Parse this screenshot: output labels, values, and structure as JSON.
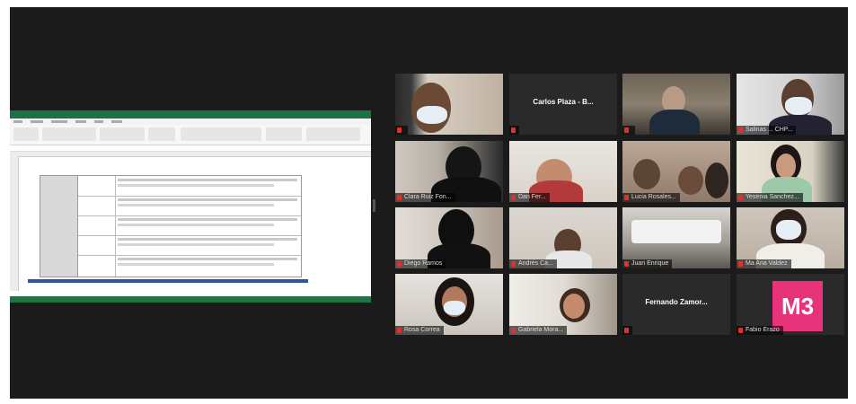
{
  "participants": [
    {
      "name": ""
    },
    {
      "name": "Carlos Plaza - B...",
      "display": "Carlos Plaza - B..."
    },
    {
      "name": ""
    },
    {
      "name": "Salinas ... CHP..."
    },
    {
      "name": "Clara Ruiz Fon..."
    },
    {
      "name": "Dan Fer..."
    },
    {
      "name": "Lucia Rosales..."
    },
    {
      "name": "Yesenia Sanchez..."
    },
    {
      "name": "Diego Ramos"
    },
    {
      "name": "Andrés Ca..."
    },
    {
      "name": "Juan Enrique"
    },
    {
      "name": "Ma Ana Valdez"
    },
    {
      "name": "Rosa Correa"
    },
    {
      "name": "Gabriela Mora..."
    },
    {
      "name": "Fernando Zamor...",
      "display": "Fernando Zamor..."
    },
    {
      "name": "Fabio Erazo"
    }
  ],
  "logo_text": "M3",
  "colors": {
    "meeting_bg": "#1b1b1b",
    "active_speaker": "#c8d86a",
    "excel_green": "#217346",
    "logo": "#e6337a",
    "mic_muted": "#e03030"
  }
}
